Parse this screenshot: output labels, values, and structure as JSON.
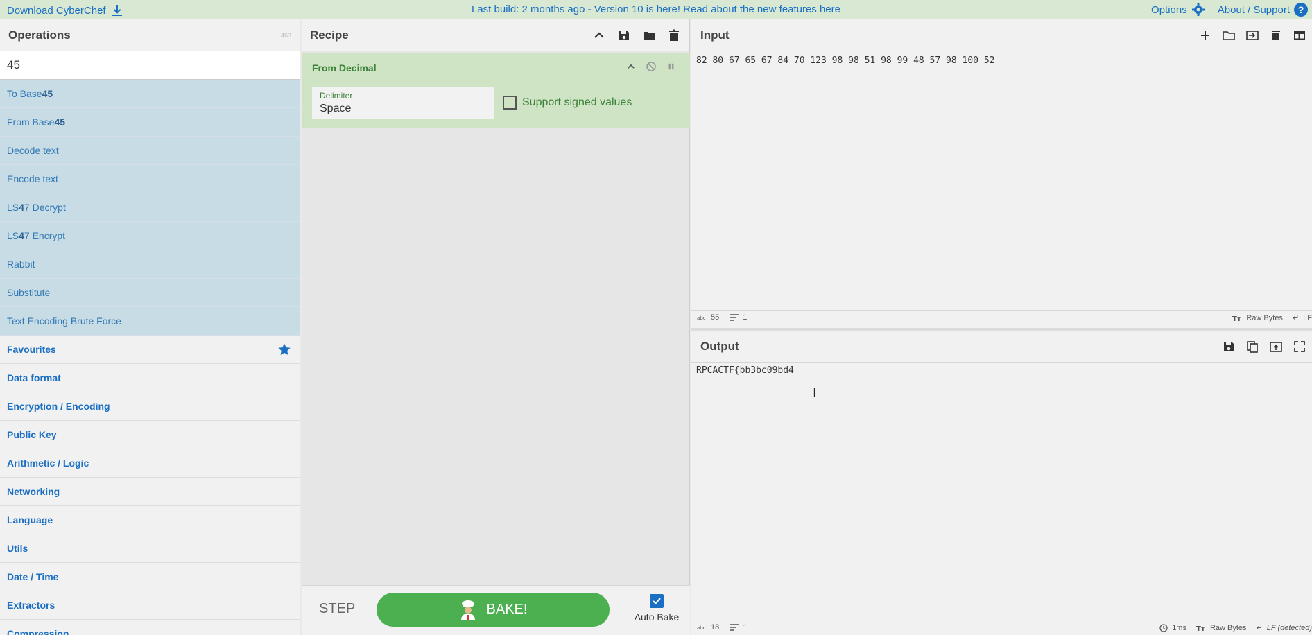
{
  "banner": {
    "download": "Download CyberChef",
    "center": "Last build: 2 months ago - Version 10 is here! Read about the new features here",
    "options": "Options",
    "about": "About / Support"
  },
  "operations": {
    "title": "Operations",
    "count": "463",
    "search_value": "45",
    "results": [
      {
        "pre": "To Base",
        "bold": "45",
        "post": ""
      },
      {
        "pre": "From Base",
        "bold": "45",
        "post": ""
      },
      {
        "pre": "Decode text",
        "bold": "",
        "post": ""
      },
      {
        "pre": "Encode text",
        "bold": "",
        "post": ""
      },
      {
        "pre": "LS",
        "bold": "4",
        "post": "7 Decrypt"
      },
      {
        "pre": "LS",
        "bold": "4",
        "post": "7 Encrypt"
      },
      {
        "pre": "Rabbit",
        "bold": "",
        "post": ""
      },
      {
        "pre": "Substitute",
        "bold": "",
        "post": ""
      },
      {
        "pre": "Text Encoding Brute Force",
        "bold": "",
        "post": ""
      }
    ],
    "categories": [
      "Favourites",
      "Data format",
      "Encryption / Encoding",
      "Public Key",
      "Arithmetic / Logic",
      "Networking",
      "Language",
      "Utils",
      "Date / Time",
      "Extractors",
      "Compression"
    ]
  },
  "recipe": {
    "title": "Recipe",
    "operation": {
      "name": "From Decimal",
      "delimiter_label": "Delimiter",
      "delimiter_value": "Space",
      "checkbox_label": "Support signed values"
    },
    "step": "STEP",
    "bake": "BAKE!",
    "auto_bake": "Auto Bake"
  },
  "input": {
    "title": "Input",
    "text": "82 80 67 65 67 84 70 123 98 98 51 98 99 48 57 98 100 52",
    "status_chars": "55",
    "status_lines": "1",
    "raw_bytes": "Raw Bytes",
    "eol": "LF"
  },
  "output": {
    "title": "Output",
    "text": "RPCACTF{bb3bc09bd4",
    "status_chars": "18",
    "status_lines": "1",
    "time": "1ms",
    "raw_bytes": "Raw Bytes",
    "eol": "LF (detected)"
  }
}
